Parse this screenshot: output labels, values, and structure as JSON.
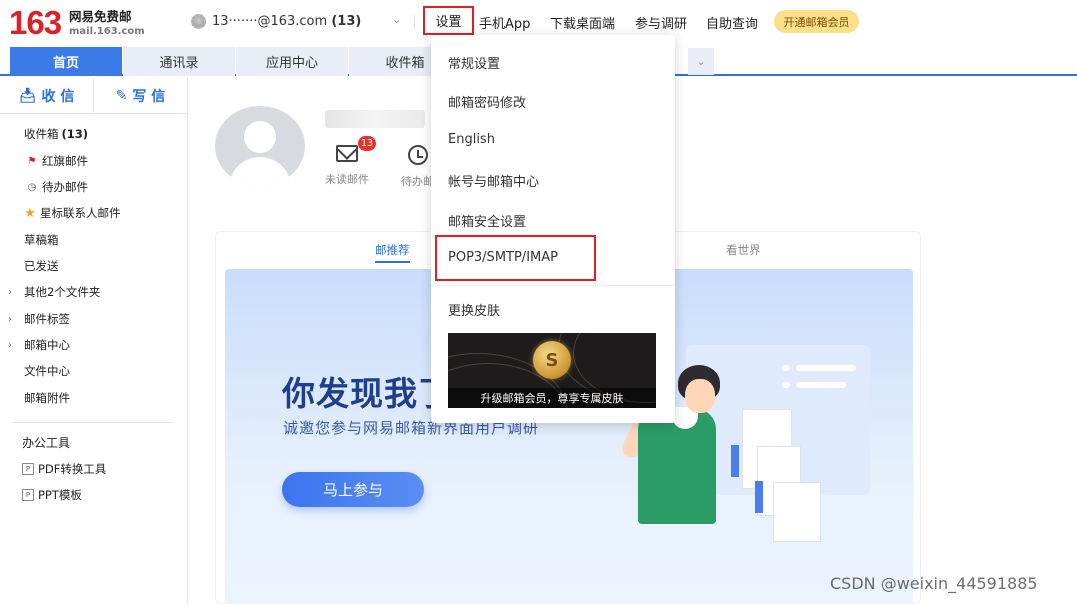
{
  "brand": {
    "number": "163",
    "name": "网易免费邮",
    "domain": "mail.163.com"
  },
  "account": {
    "email": "13·······@163.com",
    "count": "(13)"
  },
  "nav": {
    "settings": "设置",
    "mobile_app": "手机App",
    "desktop": "下载桌面端",
    "survey": "参与调研",
    "self_service": "自助查询",
    "vip": "开通邮箱会员"
  },
  "tabs": [
    {
      "label": "首页"
    },
    {
      "label": "通讯录"
    },
    {
      "label": "应用中心"
    },
    {
      "label": "收件箱"
    }
  ],
  "sidebar": {
    "receive": "收 信",
    "write": "写 信",
    "items": [
      {
        "label": "收件箱",
        "count": "(13)"
      },
      {
        "label": "红旗邮件"
      },
      {
        "label": "待办邮件"
      },
      {
        "label": "星标联系人邮件"
      },
      {
        "label": "草稿箱"
      },
      {
        "label": "已发送"
      },
      {
        "label": "其他2个文件夹"
      },
      {
        "label": "邮件标签"
      },
      {
        "label": "邮箱中心"
      },
      {
        "label": "文件中心"
      },
      {
        "label": "邮箱附件"
      }
    ],
    "tools_title": "办公工具",
    "tools": [
      {
        "label": "PDF转换工具"
      },
      {
        "label": "PPT模板"
      }
    ]
  },
  "profile": {
    "unread_label": "未读邮件",
    "unread_badge": "13",
    "todo_label": "待办邮"
  },
  "recommend": {
    "tab_active": "邮推荐",
    "tab_other": "看世界",
    "banner_title": "你发现我了",
    "banner_sub": "诚邀您参与网易邮箱新界面用户调研",
    "banner_btn": "马上参与"
  },
  "dropdown": {
    "items": [
      "常规设置",
      "邮箱密码修改",
      "English",
      "帐号与邮箱中心",
      "邮箱安全设置",
      "POP3/SMTP/IMAP",
      "更换皮肤"
    ],
    "skin_caption": "升级邮箱会员，尊享专属皮肤"
  },
  "watermark": "CSDN @weixin_44591885",
  "colors": {
    "accent": "#3a7be8",
    "highlight": "#e02020",
    "brand_red": "#d8232a",
    "vip": "#fce089"
  }
}
